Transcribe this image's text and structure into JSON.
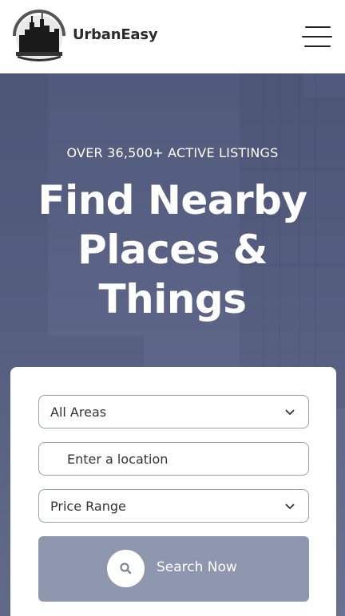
{
  "header": {
    "brand_name": "UrbanEasy",
    "logo_icon": "city-skyline-logo",
    "menu_icon": "hamburger-menu-icon"
  },
  "hero": {
    "eyebrow": "OVER 36,500+ ACTIVE LISTINGS",
    "headline_lines": [
      "Find Nearby",
      "Places &",
      "Things"
    ]
  },
  "search_form": {
    "area_select": {
      "value": "All Areas"
    },
    "location_input": {
      "placeholder": "Enter a location"
    },
    "price_select": {
      "value": "Price Range"
    },
    "submit_label": "Search Now",
    "submit_icon": "search-icon"
  },
  "colors": {
    "hero_overlay": "#5b6486",
    "button": "#8e97ae",
    "text_dark": "#2b2b2b"
  }
}
